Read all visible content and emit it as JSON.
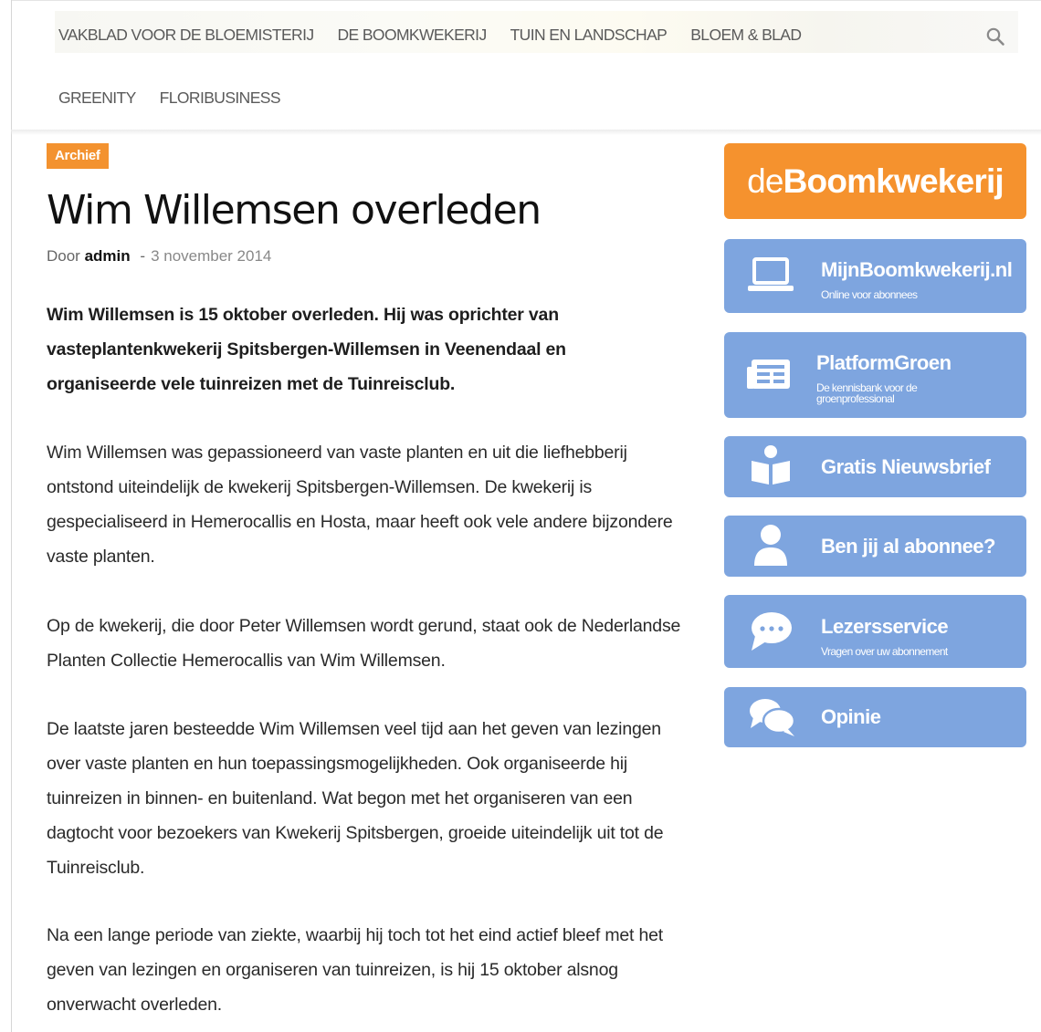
{
  "nav": {
    "row1": [
      "VAKBLAD VOOR DE BLOEMISTERIJ",
      "DE BOOMKWEKERIJ",
      "TUIN EN LANDSCHAP",
      "BLOEM & BLAD"
    ],
    "row2": [
      "GREENITY",
      "FLORIBUSINESS"
    ],
    "search_icon": "search-icon"
  },
  "article": {
    "category": "Archief",
    "title": "Wim Willemsen overleden",
    "by_label": "Door",
    "author": "admin",
    "separator": "-",
    "date": "3 november 2014",
    "lead": "Wim Willemsen is 15 oktober overleden. Hij was oprichter van vasteplantenkwekerij Spitsbergen-Willemsen in Veenendaal en organiseerde vele tuinreizen met de Tuinreisclub.",
    "paragraphs": [
      "Wim Willemsen was gepassioneerd van vaste planten en uit die liefhebberij ontstond uiteindelijk de kwekerij Spitsbergen-Willemsen. De kwekerij is gespecialiseerd in Hemerocallis en Hosta, maar heeft ook vele andere bijzondere vaste planten.",
      "Op de kwekerij, die door Peter Willemsen wordt gerund, staat ook de Nederlandse Planten Collectie Hemerocallis van Wim Willemsen.",
      "De laatste jaren besteedde Wim Willemsen veel tijd aan het geven van lezingen over vaste planten en hun toepassingsmogelijkheden. Ook organiseerde hij tuinreizen in binnen- en buitenland. Wat begon met het organiseren van een dagtocht voor bezoekers van Kwekerij Spitsbergen, groeide uiteindelijk uit tot de Tuinreisclub.",
      "Na een lange periode van ziekte, waarbij hij toch tot het eind actief bleef met het geven van lezingen en organiseren van tuinreizen, is hij 15 oktober alsnog onverwacht overleden."
    ]
  },
  "sidebar": {
    "logo_thin": "de",
    "logo_bold": "Boomkwekerij",
    "buttons": [
      {
        "label": "MijnBoomkwekerij.nl",
        "sub": "Online voor abonnees",
        "icon": "laptop-icon"
      },
      {
        "label": "PlatformGroen",
        "sub": "De kennisbank voor de groenprofessional",
        "icon": "newspaper-icon"
      },
      {
        "label": "Gratis Nieuwsbrief",
        "sub": "",
        "icon": "reader-icon"
      },
      {
        "label": "Ben jij al abonnee?",
        "sub": "",
        "icon": "user-icon"
      },
      {
        "label": "Lezersservice",
        "sub": "Vragen over uw abonnement",
        "icon": "chat-bubble-icon"
      },
      {
        "label": "Opinie",
        "sub": "",
        "icon": "comments-icon"
      }
    ]
  },
  "colors": {
    "accent_orange": "#f3922f",
    "sidebar_blue": "#7ea5df"
  }
}
